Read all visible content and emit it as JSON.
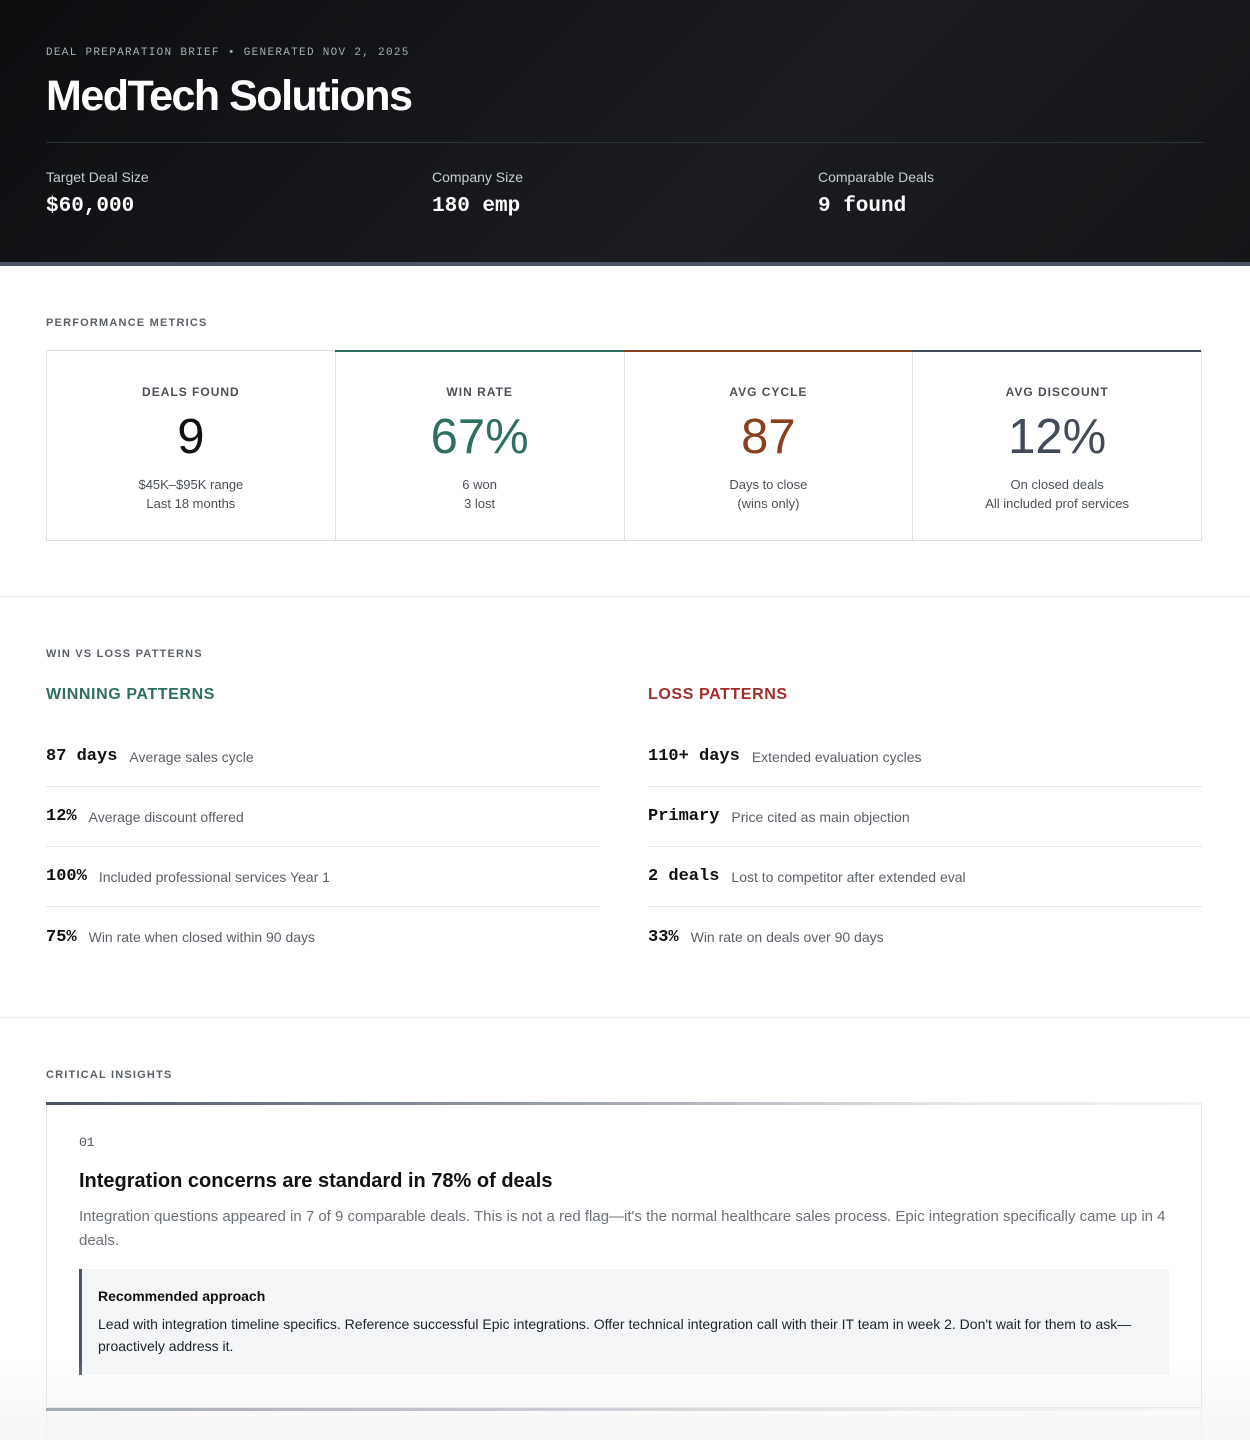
{
  "header": {
    "eyebrow_left": "DEAL PREPARATION BRIEF",
    "eyebrow_separator": "•",
    "eyebrow_right": "GENERATED NOV 2, 2025",
    "company": "MedTech Solutions",
    "stats": [
      {
        "label": "Target Deal Size",
        "value": "$60,000"
      },
      {
        "label": "Company Size",
        "value": "180 emp"
      },
      {
        "label": "Comparable Deals",
        "value": "9 found"
      }
    ]
  },
  "metrics": {
    "section_label": "PERFORMANCE METRICS",
    "cards": [
      {
        "label": "DEALS FOUND",
        "value": "9",
        "sub1": "$45K–$95K range",
        "sub2": "Last 18 months",
        "color": "#111111",
        "accent": ""
      },
      {
        "label": "WIN RATE",
        "value": "67%",
        "sub1": "6 won",
        "sub2": "3 lost",
        "color": "#2f6f62",
        "accent": "#2f6f62"
      },
      {
        "label": "AVG CYCLE",
        "value": "87",
        "sub1": "Days to close",
        "sub2": "(wins only)",
        "color": "#8a3f1d",
        "accent": "#8a3f1d"
      },
      {
        "label": "AVG DISCOUNT",
        "value": "12%",
        "sub1": "On closed deals",
        "sub2": "All included prof services",
        "color": "#434a58",
        "accent": "#434a58"
      }
    ]
  },
  "patterns": {
    "section_label": "WIN VS LOSS PATTERNS",
    "winning": {
      "title": "WINNING PATTERNS",
      "color": "#2f6f62",
      "rows": [
        {
          "stat": "87 days",
          "desc": "Average sales cycle"
        },
        {
          "stat": "12%",
          "desc": "Average discount offered"
        },
        {
          "stat": "100%",
          "desc": "Included professional services Year 1"
        },
        {
          "stat": "75%",
          "desc": "Win rate when closed within 90 days"
        }
      ]
    },
    "loss": {
      "title": "LOSS PATTERNS",
      "color": "#a32d2a",
      "rows": [
        {
          "stat": "110+ days",
          "desc": "Extended evaluation cycles"
        },
        {
          "stat": "Primary",
          "desc": "Price cited as main objection"
        },
        {
          "stat": "2 deals",
          "desc": "Lost to competitor after extended eval"
        },
        {
          "stat": "33%",
          "desc": "Win rate on deals over 90 days"
        }
      ]
    }
  },
  "insights": {
    "section_label": "CRITICAL INSIGHTS",
    "items": [
      {
        "number": "01",
        "title": "Integration concerns are standard in 78% of deals",
        "body": "Integration questions appeared in 7 of 9 comparable deals. This is not a red flag—it's the normal healthcare sales process. Epic integration specifically came up in 4 deals.",
        "approach_title": "Recommended approach",
        "approach_body": "Lead with integration timeline specifics. Reference successful Epic integrations. Offer technical integration call with their IT team in week 2. Don't wait for them to ask—proactively address it."
      }
    ]
  }
}
